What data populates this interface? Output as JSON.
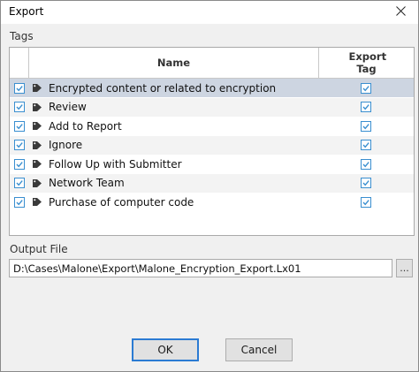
{
  "window": {
    "title": "Export",
    "close_glyph": "✕"
  },
  "tags_section": {
    "label": "Tags",
    "columns": {
      "name": "Name",
      "export_tag": "Export Tag"
    },
    "rows": [
      {
        "name": "Encrypted content or related to encryption",
        "checked": true,
        "export": true
      },
      {
        "name": "Review",
        "checked": true,
        "export": true
      },
      {
        "name": "Add to Report",
        "checked": true,
        "export": true
      },
      {
        "name": "Ignore",
        "checked": true,
        "export": true
      },
      {
        "name": "Follow Up with Submitter",
        "checked": true,
        "export": true
      },
      {
        "name": "Network Team",
        "checked": true,
        "export": true
      },
      {
        "name": "Purchase of computer code",
        "checked": true,
        "export": true
      }
    ],
    "selected_row": 0
  },
  "output_section": {
    "label": "Output File",
    "value": "D:\\Cases\\Malone\\Export\\Malone_Encryption_Export.Lx01",
    "browse_label": "..."
  },
  "buttons": {
    "ok": "OK",
    "cancel": "Cancel"
  },
  "colors": {
    "accent": "#2b7bd3",
    "check": "#3a8fd0",
    "selection": "#cdd5e1",
    "alt_row": "#f3f3f3"
  }
}
